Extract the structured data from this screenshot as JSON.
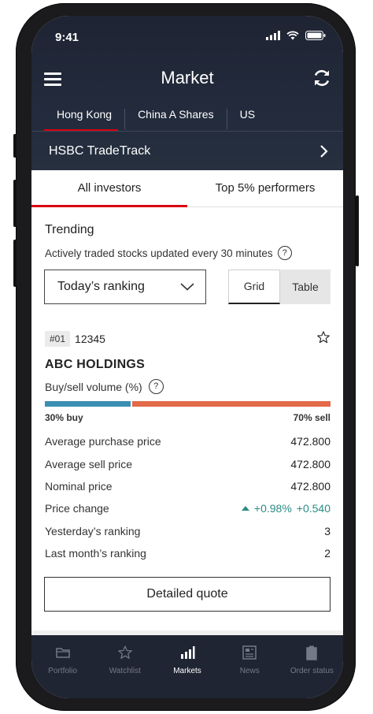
{
  "status_bar": {
    "time": "9:41"
  },
  "header": {
    "title": "Market"
  },
  "market_tabs": [
    {
      "label": "Hong Kong",
      "active": true
    },
    {
      "label": "China A Shares",
      "active": false
    },
    {
      "label": "US",
      "active": false
    }
  ],
  "tradetrack": {
    "label": "HSBC TradeTrack"
  },
  "investor_tabs": [
    {
      "label": "All investors",
      "active": true
    },
    {
      "label": "Top 5% performers",
      "active": false
    }
  ],
  "trending": {
    "title": "Trending",
    "subtitle": "Actively traded stocks updated every 30 minutes"
  },
  "filters": {
    "ranking_select": "Today’s ranking",
    "view_options": [
      "Grid",
      "Table"
    ],
    "view_selected": "Grid"
  },
  "stock": {
    "rank": "#01",
    "code": "12345",
    "name": "ABC HOLDINGS",
    "volume_label": "Buy/sell volume (%)",
    "buy_percent": 30,
    "sell_percent": 70,
    "buy_label": "30% buy",
    "sell_label": "70% sell",
    "details": [
      {
        "label": "Average purchase price",
        "value": "472.800"
      },
      {
        "label": "Average sell price",
        "value": "472.800"
      },
      {
        "label": "Nominal price",
        "value": "472.800"
      },
      {
        "label": "Price change",
        "value": "+0.98%",
        "value2": "+0.540"
      },
      {
        "label": "Yesterday’s ranking",
        "value": "3"
      },
      {
        "label": "Last month’s ranking",
        "value": "2"
      }
    ],
    "button": "Detailed quote"
  },
  "bottom_nav": [
    {
      "label": "Portfolio",
      "icon": "folder-icon"
    },
    {
      "label": "Watchlist",
      "icon": "star-icon"
    },
    {
      "label": "Markets",
      "icon": "bar-chart-icon",
      "active": true
    },
    {
      "label": "News",
      "icon": "newspaper-icon"
    },
    {
      "label": "Order status",
      "icon": "clipboard-icon"
    }
  ],
  "colors": {
    "accent_red": "#db0011",
    "buy_blue": "#3a8fb2",
    "sell_orange": "#e26a48",
    "positive_teal": "#2b8c85",
    "header_navy": "#222a3b"
  }
}
